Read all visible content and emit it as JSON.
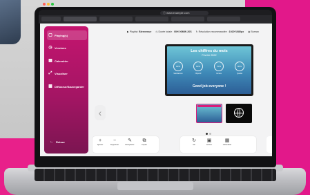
{
  "browser": {
    "url": "ⓘ www.example.com"
  },
  "sidebar": {
    "items": [
      {
        "label": "Playing(s)",
        "icon": "monitor-icon"
      },
      {
        "label": "Versions",
        "icon": "clock-icon"
      },
      {
        "label": "Calendrier",
        "icon": "calendar-icon"
      },
      {
        "label": "Visualiser",
        "icon": "expand-icon"
      },
      {
        "label": "Diffuseur/Sauvegarder",
        "icon": "screen-icon"
      }
    ],
    "back_label": "Retour"
  },
  "status": {
    "playlist_label": "Playlist:",
    "playlist_value": "Bienvenue",
    "duration_label": "Durée totale :",
    "duration_value": "00H 00MIN 20S",
    "resolution_label": "Résolution recommandée :",
    "resolution_value": "1920*1080px",
    "location_label": "Burean"
  },
  "preview": {
    "title": "Les chiffres du mois",
    "subtitle": "Février 2022",
    "stats": [
      {
        "value": "90%",
        "label": "Satisfaction"
      },
      {
        "value": "60%",
        "label": "Objectif"
      },
      {
        "value": "70%",
        "label": "Ventes"
      },
      {
        "value": "80%",
        "label": "Qualité"
      }
    ],
    "footer": "Good job everyone !"
  },
  "toolbar_left": [
    {
      "label": "Ajouter",
      "icon": "plus-icon"
    },
    {
      "label": "Supprimer",
      "icon": "minus-icon"
    },
    {
      "label": "Remplacer",
      "icon": "edit-icon"
    },
    {
      "label": "Copier",
      "icon": "copy-icon"
    }
  ],
  "toolbar_right": [
    {
      "label": "Ok",
      "icon": "refresh-icon"
    },
    {
      "label": "Activer",
      "icon": "lock-icon"
    },
    {
      "label": "Calendrier",
      "icon": "calendar-icon"
    }
  ],
  "colors": {
    "accent": "#c4156f",
    "page_dot_active": "#333333",
    "page_dot_inactive": "#bdbdbd"
  }
}
